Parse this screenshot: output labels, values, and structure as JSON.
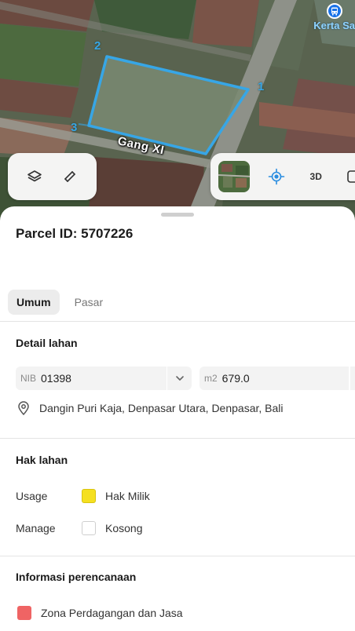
{
  "map": {
    "poi_label": "Kerta Sa",
    "vertex_labels": [
      "2",
      "1",
      "3"
    ],
    "street_label": "Gang XI",
    "layers_icon": "layers-icon",
    "measure_icon": "measure-icon",
    "gps_icon": "gps-crosshair-icon",
    "btn_3d": "3D",
    "parcel_outline_color": "#37a6e6"
  },
  "sheet": {
    "parcel_title": "Parcel ID: 5707226",
    "tabs": [
      {
        "label": "Umum",
        "active": true
      },
      {
        "label": "Pasar",
        "active": false
      }
    ],
    "detail": {
      "title": "Detail lahan",
      "nib_prefix": "NIB",
      "nib_value": "01398",
      "area_prefix": "m2",
      "area_value": "679.0",
      "address": "Dangin Puri Kaja, Denpasar Utara, Denpasar, Bali"
    },
    "hak": {
      "title": "Hak lahan",
      "usage_label": "Usage",
      "usage_value": "Hak Milik",
      "usage_color": "#f5e020",
      "manage_label": "Manage",
      "manage_value": "Kosong",
      "manage_color": "#ffffff"
    },
    "planning": {
      "title": "Informasi perencanaan",
      "zone_label": "Zona Perdagangan dan Jasa",
      "zone_color": "#ef6464"
    }
  }
}
